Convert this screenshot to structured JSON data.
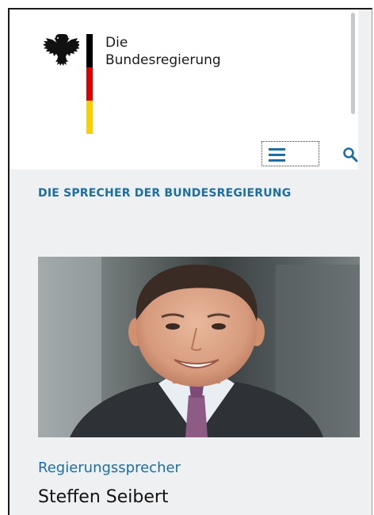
{
  "header": {
    "logo_line1": "Die",
    "logo_line2": "Bundesregierung",
    "flag_colors": [
      "#000000",
      "#dd0000",
      "#ffce00"
    ],
    "menu_icon": "hamburger-menu-icon",
    "search_icon": "search-icon"
  },
  "section": {
    "title": "DIE SPRECHER DER BUNDESREGIERUNG"
  },
  "card": {
    "photo": "portrait-photo",
    "role": "Regierungssprecher",
    "name": "Steffen Seibert"
  },
  "colors": {
    "accent": "#1b6fa3",
    "page_background": "#eef0f2",
    "header_background": "#ffffff"
  }
}
